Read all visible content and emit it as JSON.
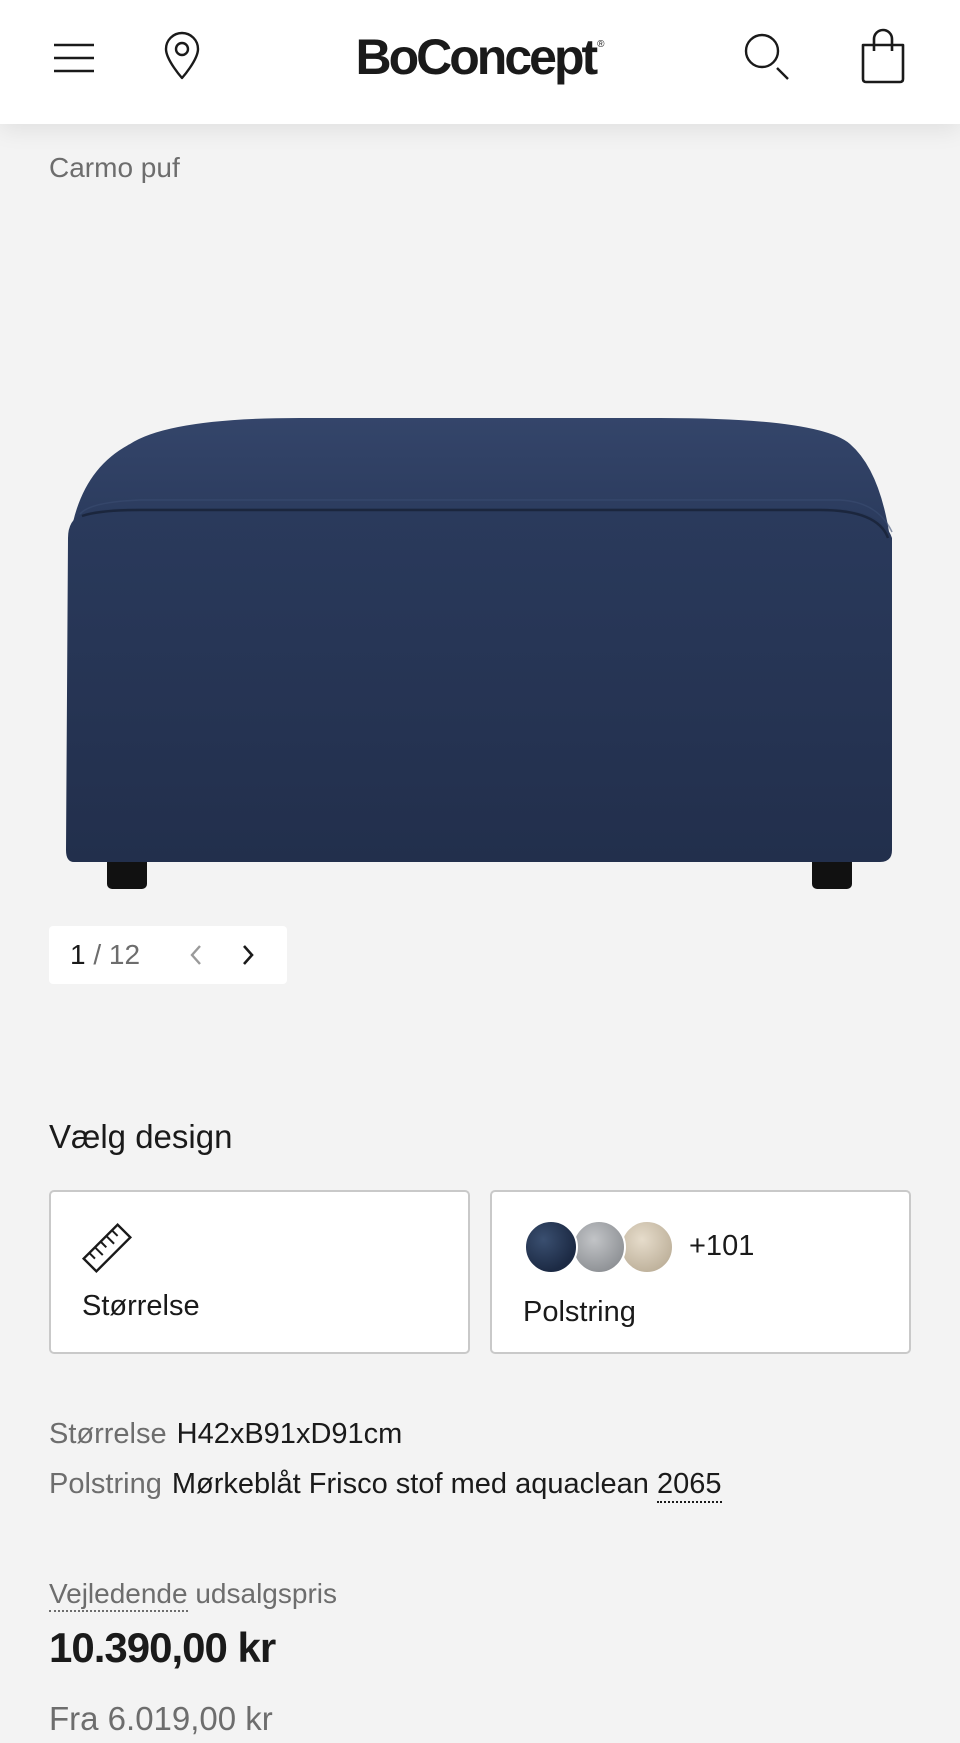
{
  "header": {
    "logo_text": "BoConcept",
    "logo_mark": "®",
    "icons": [
      "menu-icon",
      "location-pin-icon",
      "search-icon",
      "shopping-bag-icon"
    ]
  },
  "breadcrumb": "Carmo puf",
  "product": {
    "image_alt": "Carmo puf",
    "color": "#2b3a57"
  },
  "gallery": {
    "current": "1",
    "separator": "/",
    "total": "12"
  },
  "design": {
    "title": "Vælg design",
    "size_card": {
      "label": "Størrelse",
      "icon": "ruler-icon"
    },
    "upholstery_card": {
      "label": "Polstring",
      "more_count": "+101",
      "swatch_colors": [
        "#2b3a57",
        "#a9abae",
        "#d5cab7"
      ]
    }
  },
  "specs": {
    "size_key": "Størrelse",
    "size_value": "H42xB91xD91cm",
    "upholstery_key": "Polstring",
    "upholstery_value": "Mørkeblåt Frisco stof med aquaclean",
    "upholstery_code": "2065"
  },
  "pricing": {
    "label_part1": "Vejledende",
    "label_part2": "udsalgspris",
    "price": "10.390,00 kr",
    "from_price": "Fra 6.019,00 kr"
  }
}
